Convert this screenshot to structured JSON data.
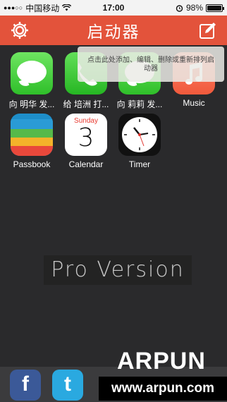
{
  "status_bar": {
    "carrier": "中国移动",
    "time": "17:00",
    "battery_percent": "98%",
    "battery_level": 0.98
  },
  "header": {
    "title": "启动器",
    "color": "#e3533b"
  },
  "tooltip": {
    "text": "点击此处添加、编辑、删除或重新排列启动器"
  },
  "launchers": [
    {
      "label": "向 明华 发...",
      "icon": "message-icon"
    },
    {
      "label": "给 培洲 打...",
      "icon": "phone-icon"
    },
    {
      "label": "向 莉莉 发...",
      "icon": "message-icon"
    },
    {
      "label": "Music",
      "icon": "music-icon"
    },
    {
      "label": "Passbook",
      "icon": "passbook-icon"
    },
    {
      "label": "Calendar",
      "icon": "calendar-icon",
      "day_name": "Sunday",
      "day_number": "3"
    },
    {
      "label": "Timer",
      "icon": "clock-icon"
    }
  ],
  "pro_label": "Pro Version",
  "dock": [
    {
      "icon": "facebook-icon",
      "glyph": "f"
    },
    {
      "icon": "twitter-icon",
      "glyph": "t"
    }
  ],
  "watermark": {
    "brand": "ARPUN",
    "url": "www.arpun.com"
  }
}
